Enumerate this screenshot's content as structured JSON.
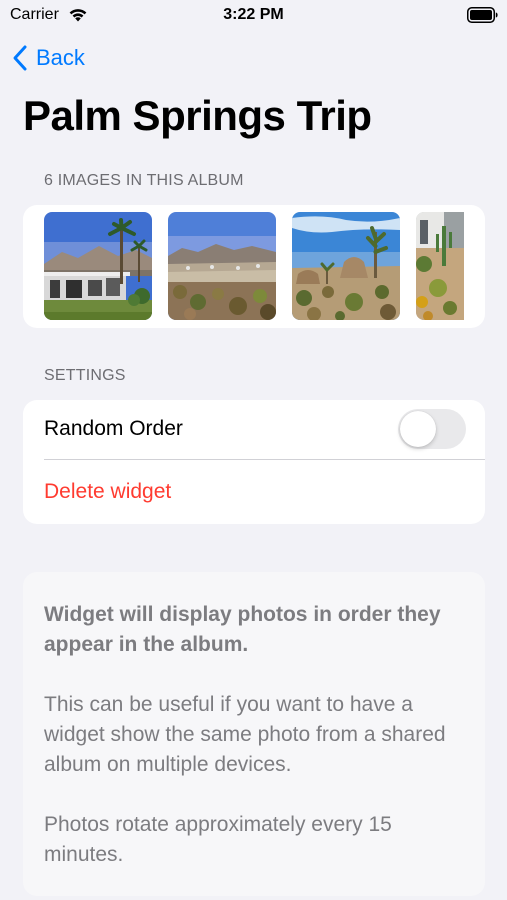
{
  "status_bar": {
    "carrier": "Carrier",
    "time": "3:22 PM",
    "wifi_icon": "wifi-icon",
    "battery_icon": "battery-full-icon"
  },
  "nav": {
    "back_label": "Back",
    "back_icon": "chevron-left-icon",
    "accent_color": "#007aff"
  },
  "page": {
    "title": "Palm Springs Trip"
  },
  "album": {
    "header": "6 IMAGES IN THIS ALBUM",
    "thumbnails": [
      {
        "name": "photo-thumbnail-1"
      },
      {
        "name": "photo-thumbnail-2"
      },
      {
        "name": "photo-thumbnail-3"
      },
      {
        "name": "photo-thumbnail-4"
      }
    ]
  },
  "settings": {
    "header": "SETTINGS",
    "random_order_label": "Random Order",
    "random_order_enabled": false,
    "delete_label": "Delete widget",
    "delete_color": "#ff3b30"
  },
  "info": {
    "bold_text": "Widget will display photos in order they appear in the album.",
    "paragraph_1": "This can be useful if you want to have a widget show the same photo from a shared album on multiple devices.",
    "paragraph_2": "Photos rotate approximately every 15 minutes."
  }
}
